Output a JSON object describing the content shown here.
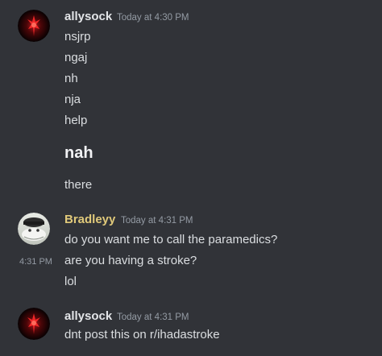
{
  "colors": {
    "background": "#313338",
    "text": "#dbdee1",
    "muted": "#949ba4",
    "allysock_name": "#e3e5e8",
    "bradleyy_name": "#e0c97a"
  },
  "messages": [
    {
      "username": "allysock",
      "timestamp": "Today at 4:30 PM",
      "avatar_icon": "red-demon-avatar-icon",
      "lines": [
        "nsjrp",
        "ngaj",
        "nh",
        "nja",
        "help",
        "nah",
        "there"
      ]
    },
    {
      "username": "Bradleyy",
      "timestamp": "Today at 4:31 PM",
      "avatar_icon": "cat-photo-avatar-icon",
      "lines": [
        "do you want me to call the paramedics?",
        "are you having a stroke?",
        "lol"
      ],
      "hover_time": "4:31 PM"
    },
    {
      "username": "allysock",
      "timestamp": "Today at 4:31 PM",
      "avatar_icon": "red-demon-avatar-icon",
      "lines": [
        "dnt post this on r/ihadastroke"
      ]
    }
  ]
}
